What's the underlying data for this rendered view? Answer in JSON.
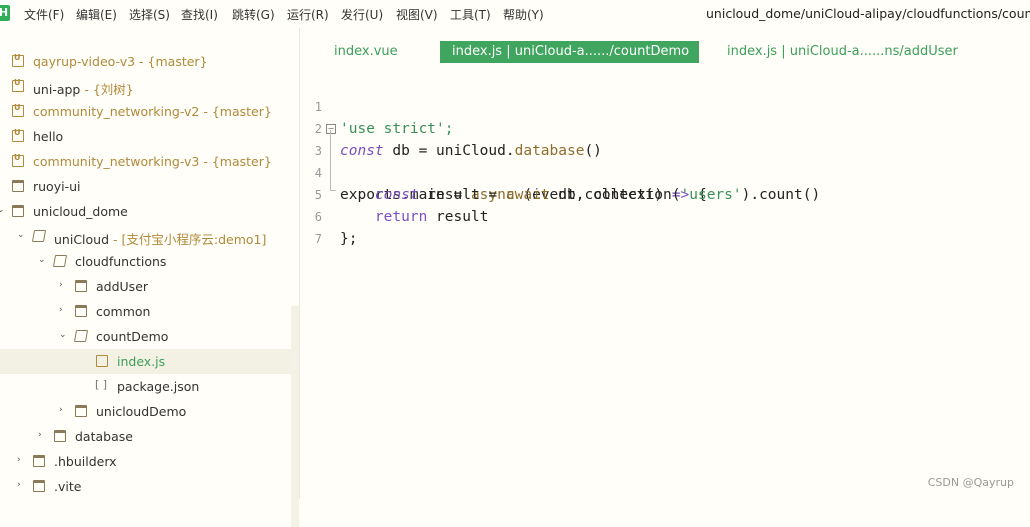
{
  "menubar": {
    "logo": "H",
    "items": [
      "文件(F)",
      "编辑(E)",
      "选择(S)",
      "查找(I)",
      "跳转(G)",
      "运行(R)",
      "发行(U)",
      "视图(V)",
      "工具(T)",
      "帮助(Y)"
    ],
    "window_title": "unicloud_dome/uniCloud-alipay/cloudfunctions/countDe"
  },
  "sidebar": {
    "items": [
      {
        "label": "qayrup-video-v3",
        "extra": " - {master}"
      },
      {
        "label": "uni-app",
        "extra": " - {刘树}"
      },
      {
        "label": "community_networking-v2",
        "extra": " - {master}"
      },
      {
        "label": "hello",
        "extra": ""
      },
      {
        "label": "community_networking-v3",
        "extra": " - {master}"
      },
      {
        "label": "ruoyi-ui",
        "extra": ""
      },
      {
        "label": "unicloud_dome",
        "extra": ""
      },
      {
        "label": "uniCloud",
        "extra": " - [支付宝小程序云:demo1]"
      },
      {
        "label": "cloudfunctions",
        "extra": ""
      },
      {
        "label": "addUser",
        "extra": ""
      },
      {
        "label": "common",
        "extra": ""
      },
      {
        "label": "countDemo",
        "extra": ""
      },
      {
        "label": "index.js",
        "extra": ""
      },
      {
        "label": "package.json",
        "extra": ""
      },
      {
        "label": "unicloudDemo",
        "extra": ""
      },
      {
        "label": "database",
        "extra": ""
      },
      {
        "label": ".hbuilderx",
        "extra": ""
      },
      {
        "label": ".vite",
        "extra": ""
      }
    ]
  },
  "tabs": [
    {
      "label": "index.vue"
    },
    {
      "label": "index.js | uniCloud-a....../countDemo"
    },
    {
      "label": "index.js | uniCloud-a......ns/addUser"
    }
  ],
  "editor": {
    "lines": [
      {
        "num": "1",
        "parts": [
          "'use strict';"
        ]
      },
      {
        "num": "2",
        "parts": [
          "const",
          " db = uniCloud.",
          "database",
          "()"
        ]
      },
      {
        "num": "3",
        "parts": [
          "exports.main = ",
          "async",
          " (event, context) ",
          "=>",
          " {"
        ]
      },
      {
        "num": "4",
        "parts": [
          "    ",
          "const",
          " result = ",
          "await",
          " db.collection(",
          "'users'",
          ").count()"
        ]
      },
      {
        "num": "5",
        "parts": [
          "    ",
          "return",
          " result"
        ]
      },
      {
        "num": "6",
        "parts": [
          "};"
        ]
      },
      {
        "num": "7",
        "parts": [
          ""
        ]
      }
    ]
  },
  "watermark": "CSDN @Qayrup"
}
